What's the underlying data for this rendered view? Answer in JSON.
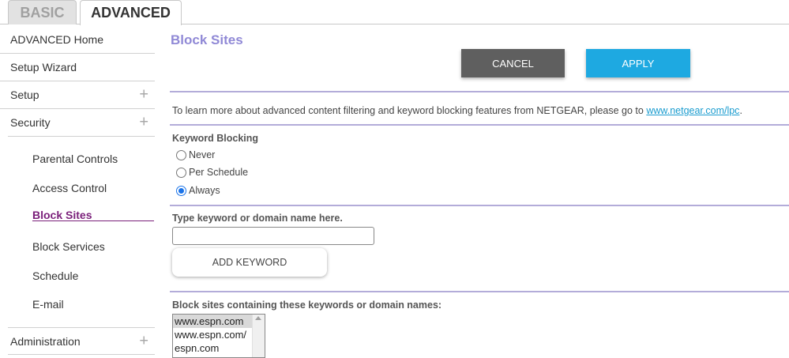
{
  "tabs": {
    "basic": "BASIC",
    "advanced": "ADVANCED"
  },
  "sidebar": {
    "top_items": [
      {
        "label": "ADVANCED Home",
        "expandable": false
      },
      {
        "label": "Setup Wizard",
        "expandable": false
      },
      {
        "label": "Setup",
        "expandable": true
      },
      {
        "label": "Security",
        "expandable": true
      }
    ],
    "sub_items": [
      {
        "label": "Parental Controls"
      },
      {
        "label": "Access Control"
      },
      {
        "label": "Block Sites",
        "active": true
      },
      {
        "label": "Block Services"
      },
      {
        "label": "Schedule"
      },
      {
        "label": "E-mail"
      }
    ],
    "bottom_item": {
      "label": "Administration",
      "expandable": true
    },
    "plus_glyph": "+"
  },
  "main": {
    "title": "Block Sites",
    "cancel_label": "CANCEL",
    "apply_label": "APPLY",
    "info_text": "To learn more about advanced content filtering and keyword blocking features from NETGEAR, please go to ",
    "info_link": "www.netgear.com/lpc",
    "info_suffix": ".",
    "keyword_blocking_label": "Keyword Blocking",
    "radio_options": [
      {
        "label": "Never",
        "checked": false
      },
      {
        "label": "Per Schedule",
        "checked": false
      },
      {
        "label": "Always",
        "checked": true
      }
    ],
    "keyword_input_label": "Type keyword or domain name here.",
    "keyword_input_value": "",
    "add_keyword_label": "ADD KEYWORD",
    "blocked_list_label": "Block sites containing these keywords or domain names:",
    "blocked_list": [
      {
        "value": "www.espn.com",
        "selected": true
      },
      {
        "value": "www.espn.com/",
        "selected": false
      },
      {
        "value": "espn.com",
        "selected": false
      }
    ]
  },
  "colors": {
    "title": "#9089d6",
    "apply": "#1ea9e1",
    "cancel": "#5f5f5f",
    "active_nav": "#7a1f7a",
    "divider": "#b3acd9",
    "link": "#1a9ccf"
  }
}
